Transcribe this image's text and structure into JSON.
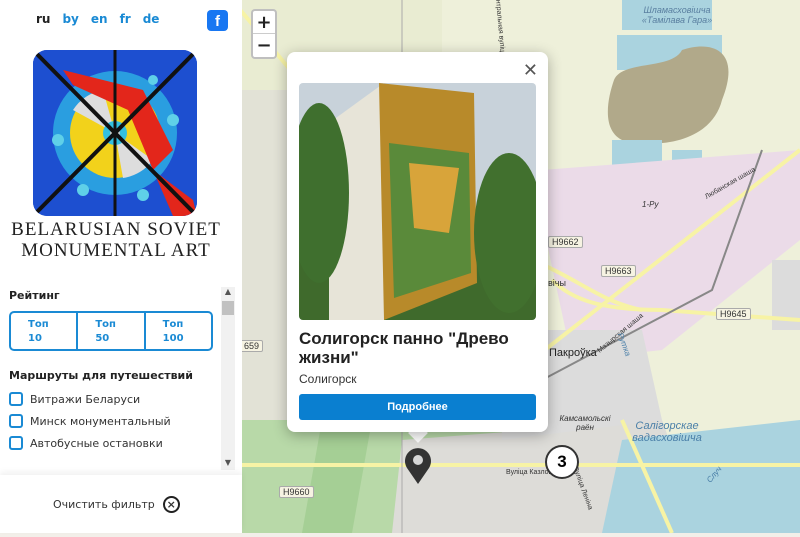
{
  "sidebar": {
    "languages": [
      {
        "code": "ru",
        "active": true
      },
      {
        "code": "by",
        "active": false
      },
      {
        "code": "en",
        "active": false
      },
      {
        "code": "fr",
        "active": false
      },
      {
        "code": "de",
        "active": false
      }
    ],
    "facebook_icon": "facebook-icon",
    "brand_line1": "BELARUSIAN SOVIET",
    "brand_line2": "MONUMENTAL ART",
    "rating_heading": "Рейтинг",
    "rating_buttons": [
      {
        "line1": "Топ",
        "line2": "10"
      },
      {
        "line1": "Топ",
        "line2": "50"
      },
      {
        "line1": "Топ",
        "line2": "100"
      }
    ],
    "routes_heading": "Маршруты для путешествий",
    "routes": [
      {
        "label": "Витражи Беларуси",
        "checked": false
      },
      {
        "label": "Минск монументальный",
        "checked": false
      },
      {
        "label": "Автобусные остановки",
        "checked": false
      }
    ],
    "clear_filter": "Очистить фильтр"
  },
  "map": {
    "zoom_in": "+",
    "zoom_out": "−",
    "labels": {
      "sludge": "Шламасховішча «Тамілава Гара»",
      "rail": "1-Ру",
      "road1": "Любанская шаша",
      "road2": "Мазырская шаша",
      "h9663": "H9663",
      "h9645": "H9645",
      "h9660": "H9660",
      "h9662": "H9662",
      "h9659": "659",
      "pakrouka": "Пакроўка",
      "district": "Камсамольскі раён",
      "reservoir": "Салігорскае вадасховішча",
      "street": "Вуліца Казлова",
      "lenina": "Вуліца Леніна",
      "central": "Цэнтральная вуліца",
      "rutka": "Рутка",
      "sluch": "Случ",
      "village": "вічы"
    },
    "cluster_count": "3",
    "colors": {
      "accent": "#1a8ad4",
      "button": "#0a7fd0",
      "water": "#aad3df",
      "forest": "#add19e",
      "industrial": "#ebdbe8"
    }
  },
  "popup": {
    "title": "Солигорск панно \"Древо жизни\"",
    "city": "Солигорск",
    "details_button": "Подробнее",
    "close_icon": "close-icon"
  }
}
